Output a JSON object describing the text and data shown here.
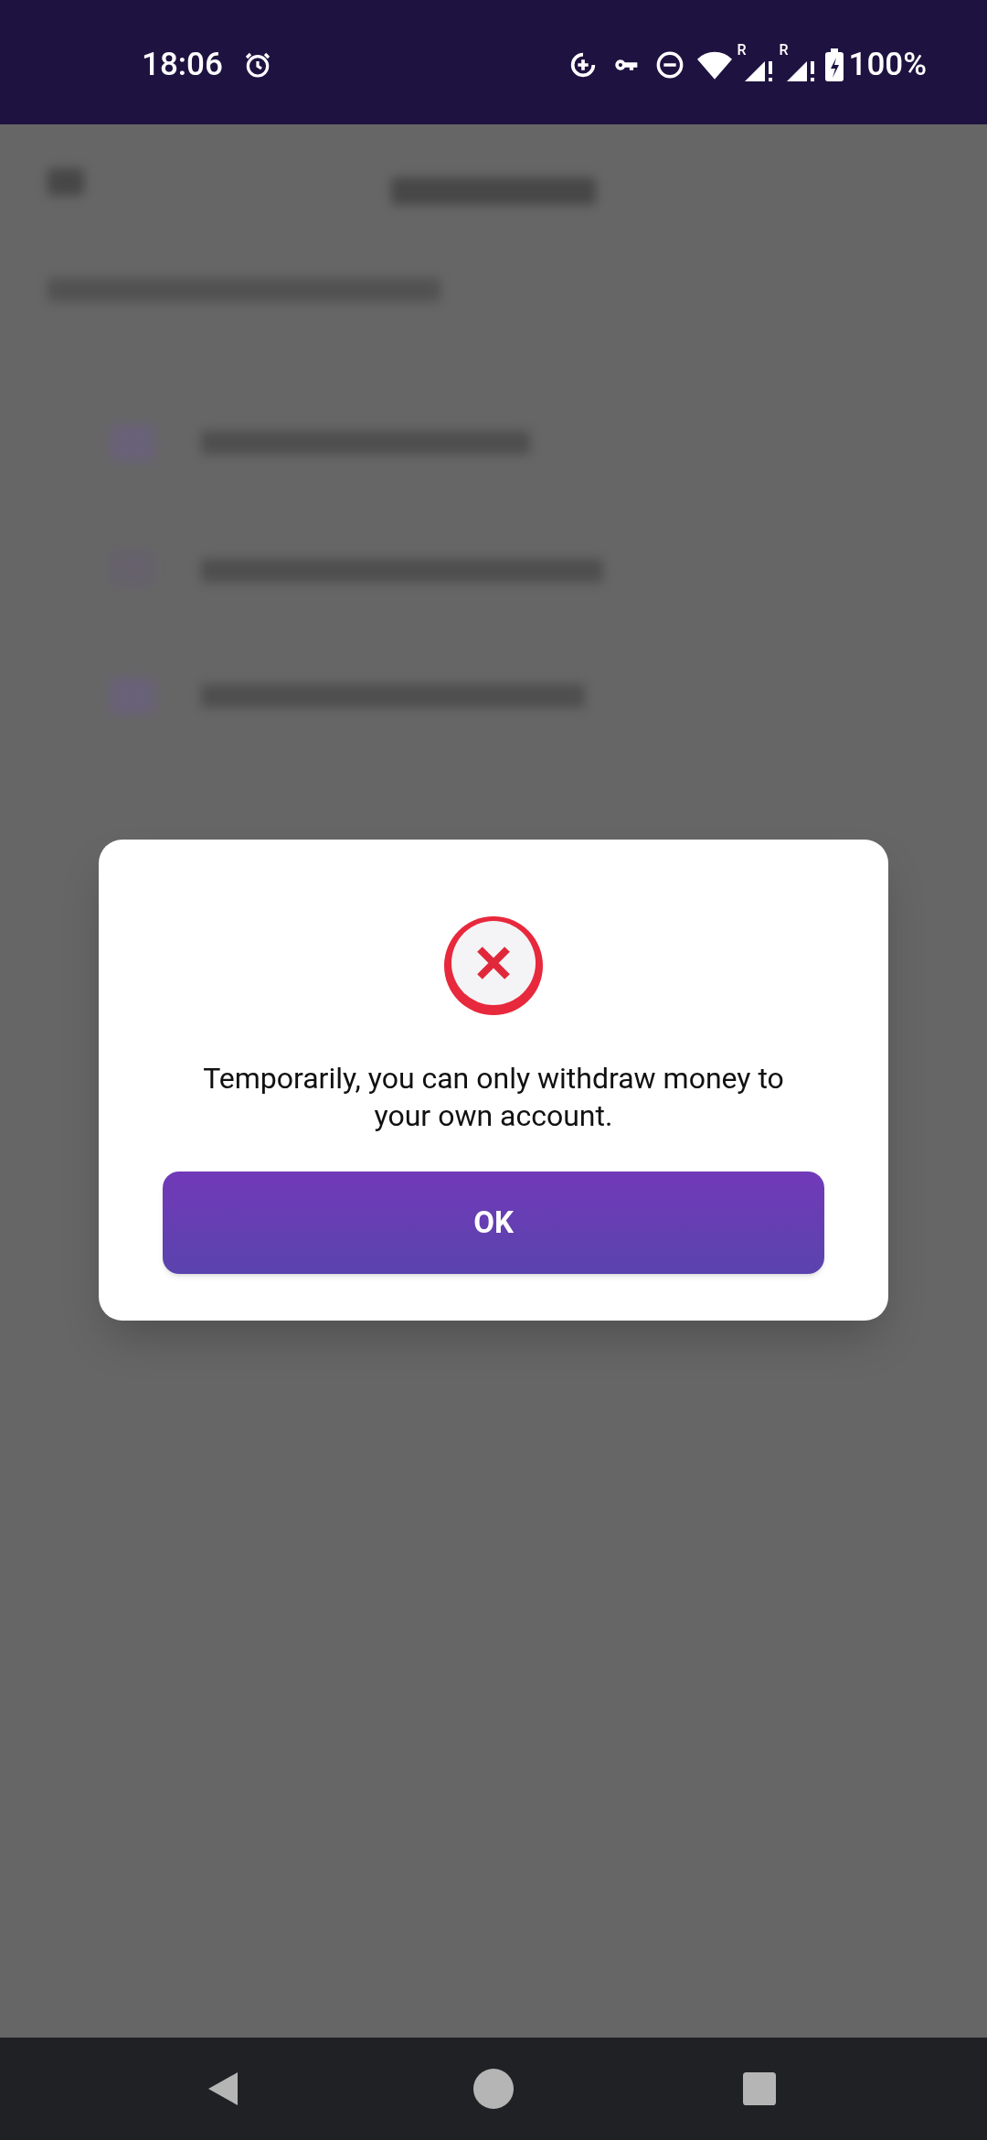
{
  "status_bar": {
    "time": "18:06",
    "battery": "100%",
    "roaming_marks": [
      "R",
      "R"
    ]
  },
  "dialog": {
    "message": "Temporarily, you can only withdraw money to your own account.",
    "button": "OK"
  }
}
